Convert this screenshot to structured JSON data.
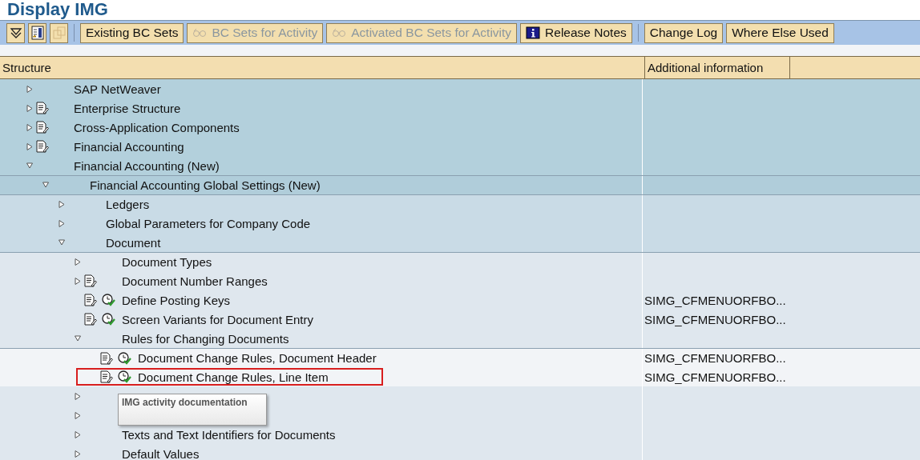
{
  "window": {
    "title": "Display IMG"
  },
  "toolbar": [
    [
      {
        "kind": "expand-all",
        "disabled": false
      },
      {
        "kind": "layout",
        "disabled": false
      },
      {
        "kind": "copy",
        "disabled": true
      }
    ],
    [
      {
        "kind": "text",
        "label": "Existing BC Sets",
        "disabled": false
      },
      {
        "kind": "glasses",
        "label": "BC Sets for Activity",
        "disabled": true
      },
      {
        "kind": "glasses",
        "label": "Activated BC Sets for Activity",
        "disabled": true
      },
      {
        "kind": "info",
        "label": "Release Notes",
        "disabled": false
      }
    ],
    [
      {
        "kind": "text",
        "label": "Change Log",
        "disabled": false
      },
      {
        "kind": "text",
        "label": "Where Else Used",
        "disabled": false
      }
    ]
  ],
  "table": {
    "columns": [
      "Structure",
      "Additional information"
    ]
  },
  "tree": [
    {
      "label": "SAP NetWeaver",
      "expanded": false,
      "doc": false,
      "activity": false
    },
    {
      "label": "Enterprise Structure",
      "expanded": false,
      "doc": true,
      "activity": false
    },
    {
      "label": "Cross-Application Components",
      "expanded": false,
      "doc": true,
      "activity": false
    },
    {
      "label": "Financial Accounting",
      "expanded": false,
      "doc": true,
      "activity": false
    },
    {
      "label": "Financial Accounting (New)",
      "expanded": true,
      "doc": false,
      "activity": false,
      "children": [
        {
          "label": "Financial Accounting Global Settings (New)",
          "expanded": true,
          "doc": false,
          "activity": false,
          "children": [
            {
              "label": "Ledgers",
              "expanded": false,
              "doc": false,
              "activity": false
            },
            {
              "label": "Global Parameters for Company Code",
              "expanded": false,
              "doc": false,
              "activity": false
            },
            {
              "label": "Document",
              "expanded": true,
              "doc": false,
              "activity": false,
              "children": [
                {
                  "label": "Document Types",
                  "expanded": false,
                  "doc": false,
                  "activity": false
                },
                {
                  "label": "Document Number Ranges",
                  "expanded": false,
                  "doc": true,
                  "activity": false
                },
                {
                  "label": "Define Posting Keys",
                  "doc": true,
                  "activity": true,
                  "info": "SIMG_CFMENUORFBO..."
                },
                {
                  "label": "Screen Variants for Document Entry",
                  "doc": true,
                  "activity": true,
                  "info": "SIMG_CFMENUORFBO..."
                },
                {
                  "label": "Rules for Changing Documents",
                  "expanded": true,
                  "doc": false,
                  "activity": false,
                  "children": [
                    {
                      "label": "Document Change Rules, Document Header",
                      "doc": true,
                      "activity": true,
                      "info": "SIMG_CFMENUORFBO...",
                      "highlighted": false
                    },
                    {
                      "label": "Document Change Rules, Line Item",
                      "doc": true,
                      "activity": true,
                      "info": "SIMG_CFMENUORFBO...",
                      "highlighted": true
                    }
                  ]
                },
                {
                  "expanded": false,
                  "doc": false,
                  "activity": false
                },
                {
                  "expanded": false,
                  "doc": false,
                  "activity": false
                },
                {
                  "label": "Texts and Text Identifiers for Documents",
                  "expanded": false,
                  "doc": false,
                  "activity": false
                },
                {
                  "label": "Default Values",
                  "expanded": false,
                  "doc": false,
                  "activity": false
                }
              ]
            }
          ]
        }
      ]
    }
  ],
  "tooltip": {
    "text": "IMG activity documentation"
  }
}
